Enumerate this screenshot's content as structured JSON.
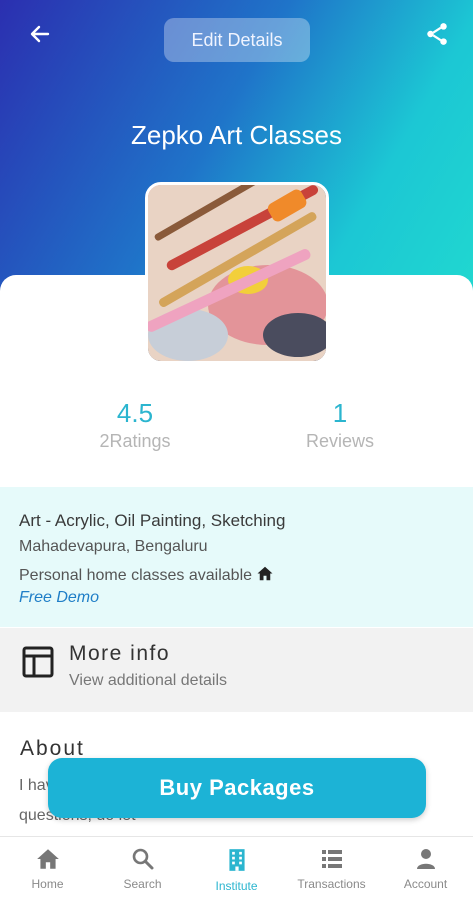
{
  "header": {
    "edit_label": "Edit Details",
    "title": "Zepko Art Classes",
    "back_icon": "arrow-left-icon",
    "share_icon": "share-icon"
  },
  "stats": {
    "rating_value": "4.5",
    "rating_label": "2Ratings",
    "reviews_value": "1",
    "reviews_label": "Reviews"
  },
  "info": {
    "category": "Art - Acrylic, Oil Painting, Sketching",
    "location": "Mahadevapura, Bengaluru",
    "home_classes": "Personal home classes available",
    "free_demo": "Free Demo"
  },
  "more_info": {
    "title": "More info",
    "subtitle": "View additional details"
  },
  "about": {
    "title": "About",
    "text": "I have ... my c... courses as well. If you have any more questions, do let"
  },
  "buy_button": "Buy Packages",
  "nav": {
    "items": [
      {
        "label": "Home",
        "icon": "home-icon"
      },
      {
        "label": "Search",
        "icon": "search-icon"
      },
      {
        "label": "Institute",
        "icon": "institute-icon"
      },
      {
        "label": "Transactions",
        "icon": "transactions-icon"
      },
      {
        "label": "Account",
        "icon": "account-icon"
      }
    ],
    "active": "Institute"
  },
  "colors": {
    "accent": "#1cb3d6",
    "stat_text": "#2bb5cf",
    "info_bg": "#e6fafa",
    "header_gradient_start": "#2b2fb0",
    "header_gradient_end": "#20d8d0"
  }
}
